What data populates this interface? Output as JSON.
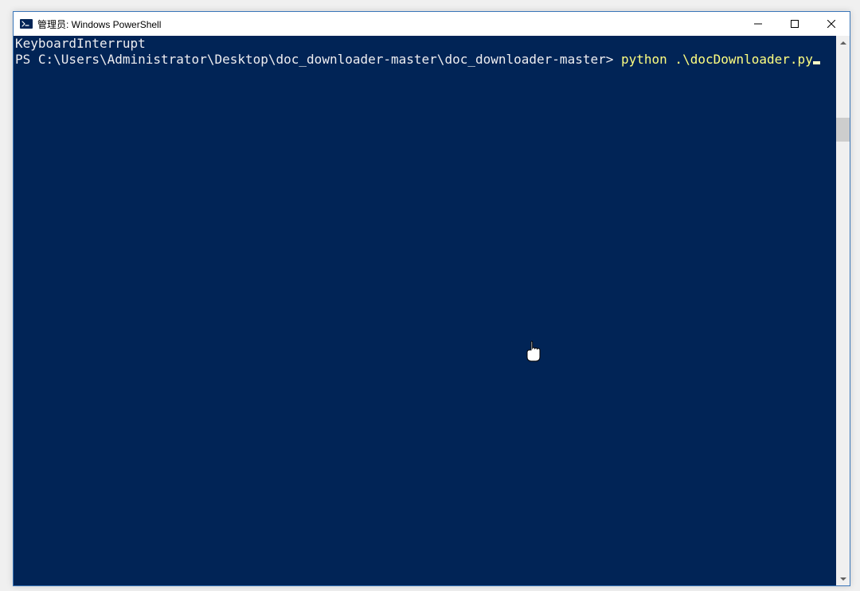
{
  "window": {
    "title": "管理员: Windows PowerShell"
  },
  "console": {
    "line1": "KeyboardInterrupt",
    "prompt": "PS C:\\Users\\Administrator\\Desktop\\doc_downloader-master\\doc_downloader-master> ",
    "command": "python .\\docDownloader.py"
  }
}
